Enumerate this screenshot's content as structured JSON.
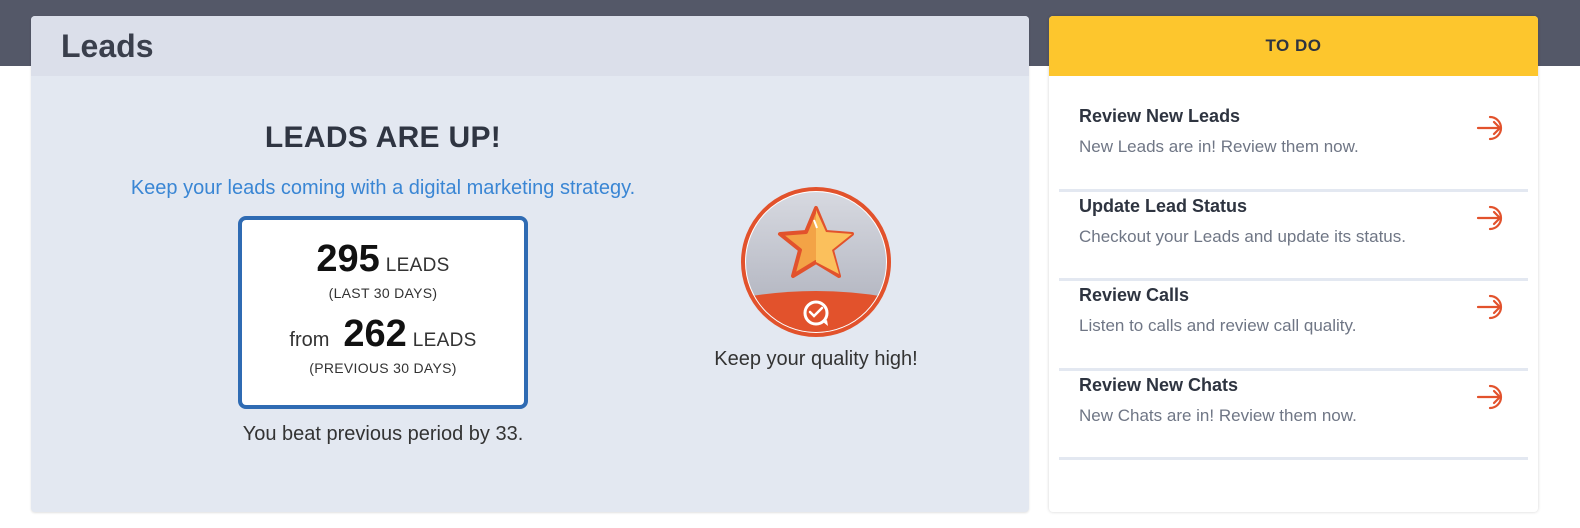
{
  "leads": {
    "title": "Leads",
    "headline": "LEADS ARE UP!",
    "tagline": "Keep your leads coming with a digital marketing strategy.",
    "current": {
      "count": "295",
      "unit": "LEADS",
      "period": "(LAST 30 DAYS)"
    },
    "previous": {
      "prefix": "from",
      "count": "262",
      "unit": "LEADS",
      "period": "(PREVIOUS 30 DAYS)"
    },
    "beat_text": "You beat previous period by 33.",
    "badge": {
      "icon": "star-quality-badge-icon",
      "caption": "Keep your quality high!"
    }
  },
  "todo": {
    "title": "TO DO",
    "items": [
      {
        "title": "Review New Leads",
        "desc": "New Leads are in! Review them now.",
        "icon": "arrow-enter-icon"
      },
      {
        "title": "Update Lead Status",
        "desc": "Checkout your Leads and update its status.",
        "icon": "arrow-enter-icon"
      },
      {
        "title": "Review Calls",
        "desc": "Listen to calls and review call quality.",
        "icon": "arrow-enter-icon"
      },
      {
        "title": "Review New Chats",
        "desc": "New Chats are in! Review them now.",
        "icon": "arrow-enter-icon"
      }
    ]
  },
  "colors": {
    "topbar": "#545868",
    "accent_blue": "#2f6bb3",
    "link_blue": "#3a86d4",
    "todo_yellow": "#fdc62d",
    "icon_orange": "#e2522c"
  }
}
